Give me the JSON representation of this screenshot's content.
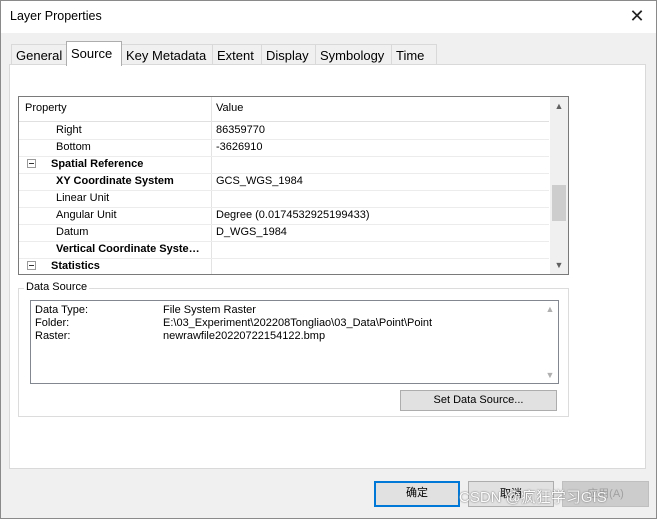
{
  "window": {
    "title": "Layer Properties",
    "close_symbol": "✕"
  },
  "tabs": [
    {
      "label": "General",
      "active": false
    },
    {
      "label": "Source",
      "active": true
    },
    {
      "label": "Key Metadata",
      "active": false
    },
    {
      "label": "Extent",
      "active": false
    },
    {
      "label": "Display",
      "active": false
    },
    {
      "label": "Symbology",
      "active": false
    },
    {
      "label": "Time",
      "active": false
    }
  ],
  "property_grid": {
    "header": {
      "property": "Property",
      "value": "Value"
    },
    "rows": [
      {
        "key": "Right",
        "value": "86359770",
        "bold": false,
        "expander": false
      },
      {
        "key": "Bottom",
        "value": "-3626910",
        "bold": false,
        "expander": false
      },
      {
        "key": "Spatial Reference",
        "value": "",
        "bold": true,
        "expander": true
      },
      {
        "key": "XY Coordinate System",
        "value": "GCS_WGS_1984",
        "bold": true,
        "expander": false
      },
      {
        "key": "Linear Unit",
        "value": "",
        "bold": false,
        "expander": false
      },
      {
        "key": "Angular Unit",
        "value": "Degree (0.0174532925199433)",
        "bold": false,
        "expander": false
      },
      {
        "key": "Datum",
        "value": "D_WGS_1984",
        "bold": false,
        "expander": false
      },
      {
        "key": "Vertical Coordinate Syste…",
        "value": "",
        "bold": true,
        "expander": false
      },
      {
        "key": "Statistics",
        "value": "",
        "bold": true,
        "expander": true
      }
    ]
  },
  "data_source": {
    "group_title": "Data Source",
    "lines": [
      {
        "label": "Data Type:",
        "value": "File System Raster"
      },
      {
        "label": "Folder:",
        "value": "E:\\03_Experiment\\202208Tongliao\\03_Data\\Point\\Point"
      },
      {
        "label": "Raster:",
        "value": "newrawfile20220722154122.bmp"
      }
    ],
    "set_button": "Set Data Source..."
  },
  "buttons": {
    "ok": "确定",
    "cancel": "取消",
    "apply": "应用(A)"
  },
  "watermark": "CSDN @疯狂学习GIS"
}
